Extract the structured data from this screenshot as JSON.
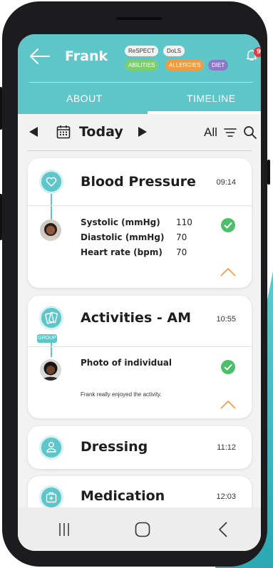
{
  "header": {
    "name": "Frank",
    "tags": [
      "ReSPECT",
      "DoLS",
      "ABILITIES",
      "ALLERGIES",
      "DIET"
    ],
    "notification_count": "9",
    "colors": {
      "brand": "#5ec6c9",
      "abilities": "#7dcf6b",
      "allergies": "#f39a3d",
      "diet": "#8c77c9",
      "badge": "#e8373d"
    }
  },
  "tabs": [
    {
      "label": "ABOUT"
    },
    {
      "label": "TIMELINE"
    }
  ],
  "toolbar": {
    "date_label": "Today",
    "filter_label": "All"
  },
  "cards": [
    {
      "title": "Blood Pressure",
      "time": "09:14",
      "icon": "heart-icon",
      "readings": [
        {
          "label": "Systolic (mmHg)",
          "value": "110"
        },
        {
          "label": "Diastolic (mmHg)",
          "value": "70"
        },
        {
          "label": "Heart rate (bpm)",
          "value": "70"
        }
      ]
    },
    {
      "title": "Activities - AM",
      "time": "10:55",
      "icon": "cards-icon",
      "group_label": "GROUP",
      "entry": "Photo of individual",
      "note": "Frank really enjoyed the activity."
    },
    {
      "title": "Dressing",
      "time": "11:12",
      "icon": "person-icon"
    },
    {
      "title": "Medication",
      "time": "12:03",
      "icon": "medkit-icon"
    }
  ]
}
